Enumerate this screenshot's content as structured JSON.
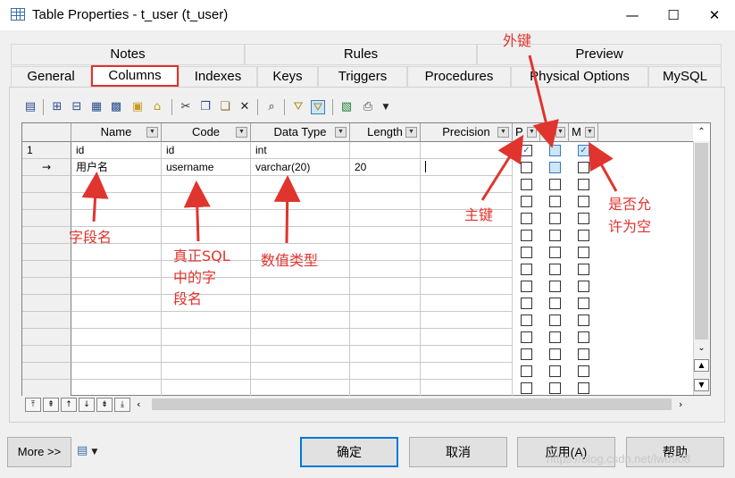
{
  "window": {
    "title": "Table Properties - t_user (t_user)",
    "minimize_glyph": "—",
    "maximize_glyph": "☐",
    "close_glyph": "✕"
  },
  "tabs_row1": [
    "Notes",
    "Rules",
    "Preview"
  ],
  "tabs_row2": [
    "General",
    "Columns",
    "Indexes",
    "Keys",
    "Triggers",
    "Procedures",
    "Physical Options",
    "MySQL"
  ],
  "active_tab": "Columns",
  "toolbar_icons": [
    "properties-icon",
    "insert-row-icon",
    "add-row-icon",
    "add-columns-icon",
    "find-columns-icon",
    "copy-icon",
    "paste-icon",
    "cut-icon",
    "copy2-icon",
    "paste2-icon",
    "delete-icon",
    "find-icon",
    "filter-icon",
    "filter-clear-icon",
    "excel-icon",
    "print-icon",
    "dropdown-icon"
  ],
  "grid": {
    "headers": [
      "Name",
      "Code",
      "Data Type",
      "Length",
      "Precision",
      "P",
      "F",
      "M"
    ],
    "rows": [
      {
        "num": "1",
        "name": "id",
        "code": "id",
        "type": "int",
        "length": "",
        "precision": "",
        "p": true,
        "f": false,
        "m": true
      },
      {
        "num": "→",
        "name": "用户名",
        "code": "username",
        "type": "varchar(20)",
        "length": "20",
        "precision": "",
        "p": false,
        "f": false,
        "m": false
      }
    ]
  },
  "annotations": {
    "foreign_key": "外键",
    "primary_key": "主键",
    "nullable_line1": "是否允",
    "nullable_line2": "许为空",
    "field_name": "字段名",
    "sql_field_line1": "真正SQL",
    "sql_field_line2": "中的字",
    "sql_field_line3": "段名",
    "datatype": "数值类型"
  },
  "buttons": {
    "more": "More >>",
    "ok": "确定",
    "cancel": "取消",
    "apply": "应用(A)",
    "help": "帮助"
  },
  "watermark": "https://blog.csdn.net/lw0908",
  "colors": {
    "accent": "#0078d7",
    "annotation": "#e0342e",
    "active_tab_border": "#e0342e"
  }
}
